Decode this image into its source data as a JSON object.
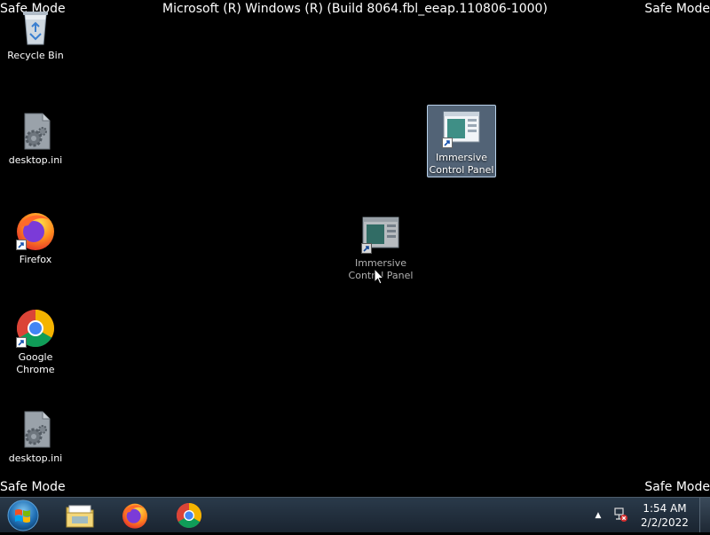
{
  "os": {
    "safe_mode_label": "Safe Mode",
    "build_text": "Microsoft (R) Windows (R) (Build 8064.fbl_eeap.110806-1000)"
  },
  "desktop": {
    "icons": [
      {
        "label": "Recycle Bin",
        "icon": "recycle-bin-icon"
      },
      {
        "label": "desktop.ini",
        "icon": "settings-file-icon"
      },
      {
        "label": "Firefox",
        "icon": "firefox-icon",
        "shortcut": true
      },
      {
        "label": "Google Chrome",
        "icon": "chrome-icon",
        "shortcut": true
      },
      {
        "label": "desktop.ini",
        "icon": "settings-file-icon"
      },
      {
        "label": "Immersive Control Panel",
        "icon": "control-panel-icon",
        "shortcut": true,
        "selected": true
      },
      {
        "label": "Immersive Control Panel",
        "icon": "control-panel-icon",
        "shortcut": true,
        "dragging": true
      }
    ]
  },
  "taskbar": {
    "start": "start-orb-icon",
    "pinned": [
      {
        "name": "Windows Explorer",
        "icon": "folder-icon"
      },
      {
        "name": "Firefox",
        "icon": "firefox-icon"
      },
      {
        "name": "Google Chrome",
        "icon": "chrome-icon"
      }
    ],
    "tray": {
      "overflow_glyph": "▲",
      "network": "network-error-icon"
    },
    "clock": {
      "time": "1:54 AM",
      "date": "2/2/2022"
    }
  },
  "colors": {
    "desktop_bg": "#000000",
    "taskbar_bg": "#1a2430",
    "selection": "#96b4d7"
  }
}
